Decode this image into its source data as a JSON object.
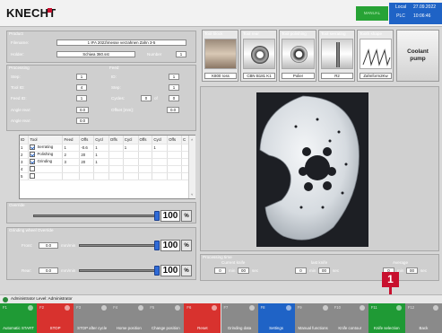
{
  "header": {
    "brand": "KNECHT",
    "mode": "MANUAL",
    "location_line1": "Local",
    "location_line2": "PLC",
    "date": "27.09.2022",
    "time": "10:06:46"
  },
  "product": {
    "section": "Product",
    "filename_label": "Filename:",
    "filename": "1 IFA 2022\\messe verzahnen Zahn 3-5",
    "holder_label": "Holder:",
    "holder": "Schiwa 360.sst",
    "number_label": "Number",
    "number": "1"
  },
  "processing": {
    "section": "Processing",
    "step_label": "Step:",
    "step": "1",
    "tool_id_label": "Tool ID:",
    "tool_id": "4",
    "feed_id_label": "Feed ID:",
    "feed_id": "1",
    "angle_rear_label": "Angle rear:",
    "angle_rear": "0.0",
    "angle_front_label": "Angle rear:",
    "angle_front": "0.0"
  },
  "feed": {
    "section": "Feed",
    "id_label": "ID:",
    "id": "1",
    "step_label": "Step:",
    "step": "1",
    "cycles_label": "Cycles:",
    "cycles_a": "0",
    "cycles_of": "of",
    "cycles_b": "0",
    "offset_label": "Offset [mm]:",
    "offset": "0.0"
  },
  "tools_table": {
    "headers": [
      "ID",
      "Tool",
      "Feed",
      "Offs",
      "Cycl",
      "Offs",
      "Cycl",
      "Offs",
      "Cycl",
      "Offs",
      "C"
    ],
    "rows": [
      [
        "1",
        "Serrating",
        "1",
        "-0.6",
        "1",
        "",
        "1",
        "",
        "1",
        ""
      ],
      [
        "2",
        "Polishing",
        "2",
        "20",
        "1",
        "",
        "",
        "",
        "",
        ""
      ],
      [
        "3",
        "Grinding",
        "3",
        "20",
        "1",
        "",
        "",
        "",
        "",
        ""
      ],
      [
        "4",
        "",
        "",
        "",
        "",
        "",
        "",
        "",
        "",
        ""
      ],
      [
        "5",
        "",
        "",
        "",
        "",
        "",
        "",
        "",
        "",
        ""
      ]
    ],
    "checked": [
      true,
      true,
      true,
      false,
      false
    ]
  },
  "override": {
    "section": "Override",
    "value": "100",
    "unit": "%",
    "level": 100
  },
  "grinding": {
    "section": "Grinding wheel Override",
    "front_label": "Front:",
    "front_value": "0.0",
    "front_unit": "mm/min",
    "front_level": 100,
    "front_pct": "100",
    "rear_label": "Rear:",
    "rear_value": "0.0",
    "rear_unit": "mm/min",
    "rear_level": 100,
    "rear_pct": "100",
    "pct_unit": "%"
  },
  "tools": [
    {
      "title": "Tool block",
      "name": "K800 ross"
    },
    {
      "title": "Tool rear",
      "name": "CBN B181 K1"
    },
    {
      "title": "Tool polishing",
      "name": "Polier"
    },
    {
      "title": "Tool serrating",
      "name": "R2"
    },
    {
      "title": "Tooth shape",
      "name": "Zahnform2Kw"
    }
  ],
  "coolant": {
    "line1": "Coolant",
    "line2": "pump"
  },
  "processing_time": {
    "section": "Processing time",
    "current_label": "Current knife",
    "last_label": "last knife",
    "average_label": "Average",
    "min": "min",
    "sec": "sec",
    "current_min": "0",
    "current_sec": "00",
    "last_min": "0",
    "last_sec": "00",
    "avg_min": "0",
    "avg_sec": "00"
  },
  "user_bar": {
    "text": "Administrator  Level: Administrator"
  },
  "marker": {
    "label": "1"
  },
  "fkeys": [
    {
      "num": "F1",
      "label": "Automatic START",
      "color": "#1f9a35",
      "icon": "play-icon"
    },
    {
      "num": "F2",
      "label": "STOP",
      "color": "#d8322e",
      "icon": "stop-icon"
    },
    {
      "num": "F3",
      "label": "STOP after cycle",
      "color": "#8a8a8a",
      "icon": "stop-icon"
    },
    {
      "num": "F4",
      "label": "Home position",
      "color": "#8a8a8a",
      "icon": "home-icon"
    },
    {
      "num": "F5",
      "label": "Change position",
      "color": "#8a8a8a",
      "icon": "change-icon"
    },
    {
      "num": "F6",
      "label": "Reset",
      "color": "#d8322e",
      "icon": "reset-icon"
    },
    {
      "num": "F7",
      "label": "Grinding data",
      "color": "#8a8a8a",
      "icon": "data-icon"
    },
    {
      "num": "F8",
      "label": "Settings",
      "color": "#1f63c6",
      "icon": "settings-icon"
    },
    {
      "num": "F9",
      "label": "Manual functions",
      "color": "#8a8a8a",
      "icon": "hand-icon"
    },
    {
      "num": "F10",
      "label": "Knife contour",
      "color": "#8a8a8a",
      "icon": "contour-icon"
    },
    {
      "num": "F11",
      "label": "Knife selection",
      "color": "#1f9a35",
      "icon": "file-icon"
    },
    {
      "num": "F12",
      "label": "Back",
      "color": "#8a8a8a",
      "icon": "back-icon"
    }
  ]
}
